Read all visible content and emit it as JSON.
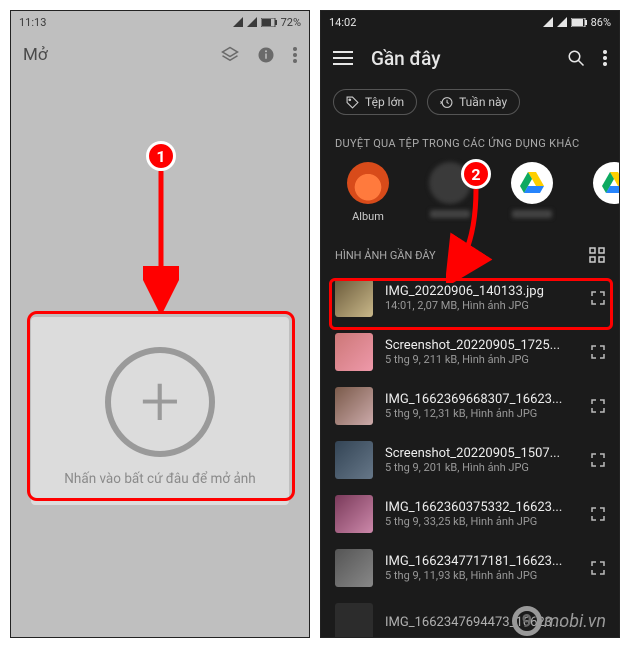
{
  "left": {
    "status": {
      "time": "11:13",
      "battery": "72%"
    },
    "toolbar_title": "Mở",
    "add_text": "Nhấn vào bất cứ đâu để mở ảnh"
  },
  "right": {
    "status": {
      "time": "14:02",
      "battery": "86%"
    },
    "toolbar_title": "Gần đây",
    "chip_large": "Tệp lớn",
    "chip_week": "Tuần này",
    "browse_section": "DUYỆT QUA TỆP TRONG CÁC ỨNG DỤNG KHÁC",
    "apps": {
      "album": "Album",
      "blur1": "",
      "drive": "",
      "drive2": ""
    },
    "recent_section": "HÌNH ẢNH GẦN ĐÂY",
    "files": [
      {
        "name": "IMG_20220906_140133.jpg",
        "meta": "14:01, 2,07 MB, Hình ảnh JPG"
      },
      {
        "name": "Screenshot_20220905_1725...",
        "meta": "5 thg 9, 211 kB, Hình ảnh JPG"
      },
      {
        "name": "IMG_1662369668307_16623...",
        "meta": "5 thg 9, 12,31 kB, Hình ảnh JPG"
      },
      {
        "name": "Screenshot_20220905_1507...",
        "meta": "5 thg 9, 201 kB, Hình ảnh JPG"
      },
      {
        "name": "IMG_1662360375332_16623...",
        "meta": "5 thg 9, 33,25 kB, Hình ảnh JPG"
      },
      {
        "name": "IMG_1662347717181_16623...",
        "meta": "5 thg 9, 11,93 kB, Hình ảnh JPG"
      },
      {
        "name": "IMG_1662347694473_16623...",
        "meta": ""
      }
    ]
  },
  "callouts": {
    "one": "1",
    "two": "2"
  },
  "watermark": {
    "nine": "9",
    "text": "mobi.vn"
  }
}
